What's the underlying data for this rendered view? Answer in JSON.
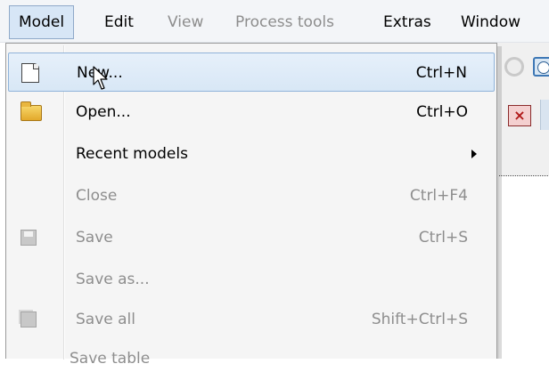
{
  "menubar": {
    "items": [
      {
        "label": "Model",
        "state": "open"
      },
      {
        "label": "Edit",
        "state": "enabled"
      },
      {
        "label": "View",
        "state": "disabled"
      },
      {
        "label": "Process tools",
        "state": "disabled"
      },
      {
        "label": "Extras",
        "state": "enabled"
      },
      {
        "label": "Window",
        "state": "enabled"
      }
    ]
  },
  "model_menu": {
    "items": [
      {
        "label": "New...",
        "shortcut": "Ctrl+N",
        "icon": "new-document-icon",
        "state": "highlighted"
      },
      {
        "label": "Open...",
        "shortcut": "Ctrl+O",
        "icon": "open-folder-icon",
        "state": "enabled"
      },
      {
        "label": "Recent models",
        "shortcut": "",
        "icon": "",
        "state": "enabled",
        "submenu": true
      },
      {
        "label": "Close",
        "shortcut": "Ctrl+F4",
        "icon": "",
        "state": "disabled"
      },
      {
        "label": "Save",
        "shortcut": "Ctrl+S",
        "icon": "save-icon",
        "state": "disabled"
      },
      {
        "label": "Save as...",
        "shortcut": "",
        "icon": "",
        "state": "disabled"
      },
      {
        "label": "Save all",
        "shortcut": "Shift+Ctrl+S",
        "icon": "save-all-icon",
        "state": "disabled"
      }
    ],
    "partial_item_label": "Save table"
  },
  "colors": {
    "menubar_bg": "#f3f5f8",
    "open_menu_bg": "#d7e6f6",
    "highlight_border": "#8fb3d9",
    "disabled_text": "#8e8e8e"
  }
}
